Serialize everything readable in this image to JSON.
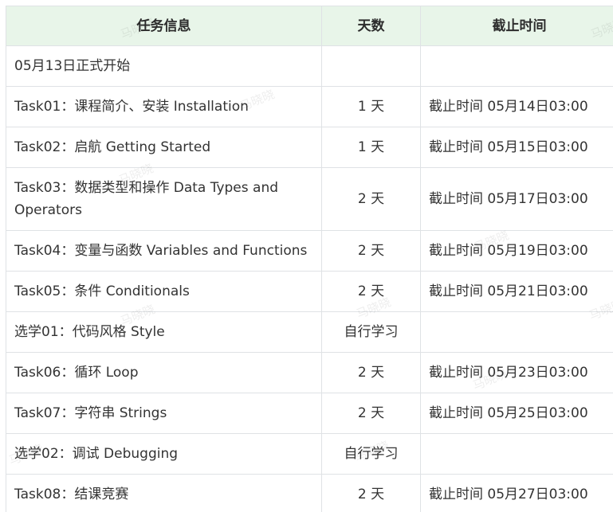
{
  "watermark": "马晓晓",
  "table": {
    "headers": [
      "任务信息",
      "天数",
      "截止时间"
    ],
    "rows": [
      {
        "task": "05月13日正式开始",
        "days": "",
        "deadline": ""
      },
      {
        "task": "Task01：课程简介、安装 Installation",
        "days": "1 天",
        "deadline": "截止时间 05月14日03:00"
      },
      {
        "task": "Task02：启航 Getting Started",
        "days": "1 天",
        "deadline": "截止时间 05月15日03:00"
      },
      {
        "task": "Task03：数据类型和操作 Data Types and Operators",
        "days": "2 天",
        "deadline": "截止时间 05月17日03:00"
      },
      {
        "task": "Task04：变量与函数 Variables and Functions",
        "days": "2 天",
        "deadline": "截止时间 05月19日03:00"
      },
      {
        "task": "Task05：条件 Conditionals",
        "days": "2 天",
        "deadline": "截止时间 05月21日03:00"
      },
      {
        "task": "选学01：代码风格 Style",
        "days": "自行学习",
        "deadline": ""
      },
      {
        "task": "Task06：循环 Loop",
        "days": "2 天",
        "deadline": "截止时间 05月23日03:00"
      },
      {
        "task": "Task07：字符串 Strings",
        "days": "2 天",
        "deadline": "截止时间 05月25日03:00"
      },
      {
        "task": "选学02：调试 Debugging",
        "days": "自行学习",
        "deadline": ""
      },
      {
        "task": "Task08：结课竞赛",
        "days": "2 天",
        "deadline": "截止时间 05月27日03:00"
      }
    ]
  }
}
